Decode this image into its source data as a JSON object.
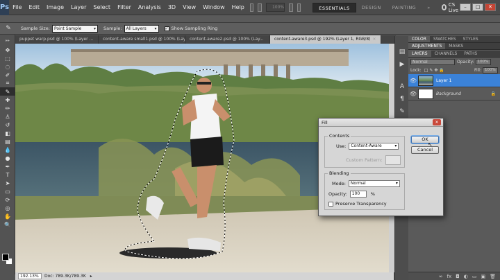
{
  "app": {
    "logo": "Ps"
  },
  "menu": [
    "File",
    "Edit",
    "Image",
    "Layer",
    "Select",
    "Filter",
    "Analysis",
    "3D",
    "View",
    "Window",
    "Help"
  ],
  "menubar": {
    "zoom": "100%",
    "workspaces": [
      "ESSENTIALS",
      "DESIGN",
      "PAINTING"
    ],
    "workspace_more": "»",
    "cs_live": "CS Live"
  },
  "options": {
    "sample_size_label": "Sample Size:",
    "sample_size_value": "Point Sample",
    "sample_label": "Sample:",
    "sample_value": "All Layers",
    "ring_checked": true,
    "ring_label": "Show Sampling Ring"
  },
  "tabs": [
    {
      "label": "puppet warp.psd @ 100% (Layer ..."
    },
    {
      "label": "content-aware small1.psd @ 100% (Lay..."
    },
    {
      "label": "content-aware2.psd @ 100% (Lay..."
    },
    {
      "label": "content-aware3.psd @ 192% (Layer 1, RGB/8)",
      "active": true
    }
  ],
  "status": {
    "zoom": "192.13%",
    "doc": "Doc: 789.3K/789.3K"
  },
  "panels": {
    "top_tabs": [
      "COLOR",
      "SWATCHES",
      "STYLES"
    ],
    "mid_tabs": [
      "ADJUSTMENTS",
      "MASKS"
    ],
    "layer_tabs": [
      "LAYERS",
      "CHANNELS",
      "PATHS"
    ],
    "blend_mode": "Normal",
    "opacity_label": "Opacity:",
    "opacity_value": "100%",
    "lock_label": "Lock:",
    "fill_label": "Fill:",
    "fill_value": "100%",
    "layers": [
      {
        "name": "Layer 1",
        "selected": true
      },
      {
        "name": "Background",
        "locked": true
      }
    ]
  },
  "dialog": {
    "title": "Fill",
    "contents_group": "Contents",
    "use_label": "Use:",
    "use_value": "Content-Aware",
    "custom_pattern_label": "Custom Pattern:",
    "blending_group": "Blending",
    "mode_label": "Mode:",
    "mode_value": "Normal",
    "opacity_label": "Opacity:",
    "opacity_value": "100",
    "opacity_unit": "%",
    "preserve_label": "Preserve Transparency",
    "preserve_checked": false,
    "ok": "OK",
    "cancel": "Cancel"
  },
  "colors": {
    "selection_highlight": "#3b82d8",
    "ps_blue": "#9cc3ee",
    "active_workspace_bg": "#2b2b2b"
  }
}
